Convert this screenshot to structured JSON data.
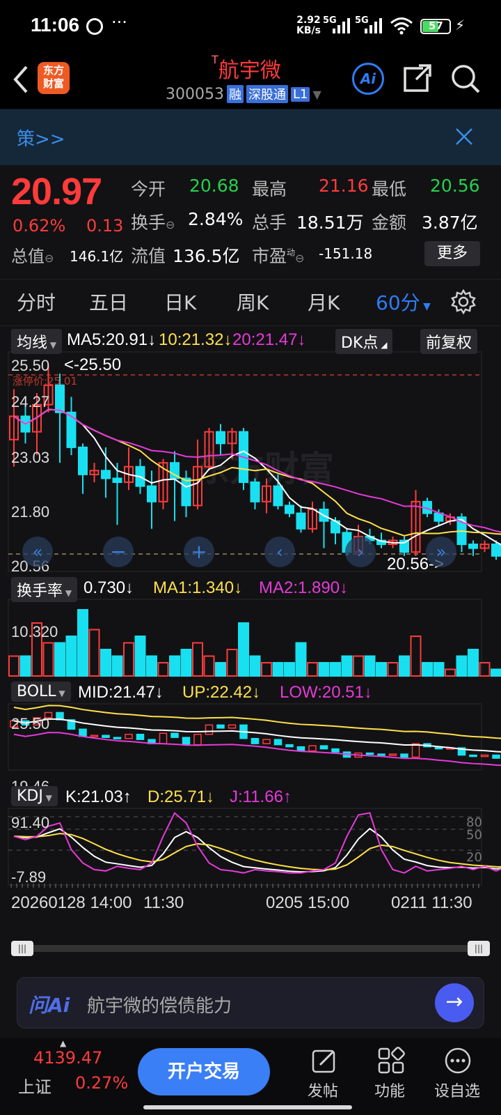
{
  "status": {
    "time": "11:06",
    "net_speed_top": "2.92",
    "net_speed_unit": "KB/s",
    "battery": "57",
    "net_5g_1": "5G",
    "net_5g_2": "5G"
  },
  "header": {
    "back_icon": "back-arrow-icon",
    "logo_line1": "东方",
    "logo_line2": "财富",
    "title": "航宇微",
    "title_prefix": "T",
    "code": "300053",
    "tag_rong": "融",
    "tag_sgt": "深股通",
    "tag_level": "L1",
    "ai_label": "Ai"
  },
  "banner": {
    "text": "策>>"
  },
  "quote": {
    "price": "20.97",
    "pct": "0.62%",
    "change": "0.13",
    "open_label": "今开",
    "open": "20.68",
    "high_label": "最高",
    "high": "21.16",
    "low_label": "最低",
    "low": "20.56",
    "turnover_label": "换手",
    "turnover": "2.84%",
    "volume_label": "总手",
    "volume": "18.51万",
    "amount_label": "金额",
    "amount": "3.87亿",
    "mktcap_label": "总值",
    "mktcap": "146.1亿",
    "float_label": "流值",
    "float": "136.5亿",
    "pe_label": "市盈",
    "pe_sup": "动",
    "pe": "-151.18",
    "more": "更多"
  },
  "tabs": [
    "分时",
    "五日",
    "日K",
    "周K",
    "月K",
    "60分"
  ],
  "kline": {
    "ma_label": "均线",
    "ma5": "MA5:20.91↓",
    "ma10": "10:21.32↓",
    "ma20": "20:21.47↓",
    "dk": "DK点",
    "fq": "前复权",
    "y_labels": [
      "25.50",
      "24.27",
      "23.03",
      "21.80",
      "20.56"
    ],
    "limit_label": "涨停价:25.01",
    "hi_marker": "<-25.50",
    "lo_marker": "20.56->",
    "watermark": "东方财富"
  },
  "turnover_panel": {
    "label": "换手率",
    "value": "0.730↓",
    "ma1": "MA1:1.340↓",
    "ma2": "MA2:1.890↓",
    "y_top": "10.320"
  },
  "boll_panel": {
    "label": "BOLL",
    "mid": "MID:21.47↓",
    "up": "UP:22.42↓",
    "low": "LOW:20.51↓",
    "y_top": "25.50",
    "y_bot": "19.46"
  },
  "kdj_panel": {
    "label": "KDJ",
    "k": "K:21.03↑",
    "d": "D:25.71↓",
    "j": "J:11.66↑",
    "y_top": "91.40",
    "y_bot": "-7.89",
    "r80": "80",
    "r50": "50",
    "r20": "20"
  },
  "x_axis": [
    "20260128 14:00",
    "11:30",
    "0205 15:00",
    "0211 11:30"
  ],
  "ai_bar": {
    "brand": "问Ai",
    "placeholder": "航宇微的偿债能力"
  },
  "bottom": {
    "index_value": "4139.47",
    "index_name": "上证",
    "index_pct": "0.27%",
    "trade": "开户交易",
    "post": "发帖",
    "func": "功能",
    "watch": "设自选"
  },
  "colors": {
    "up": "#ff3b3b",
    "down": "#19e0f0",
    "ma5": "#ffffff",
    "ma10": "#ffe14a",
    "ma20": "#e63ad8",
    "accent": "#2f7cf6"
  }
}
